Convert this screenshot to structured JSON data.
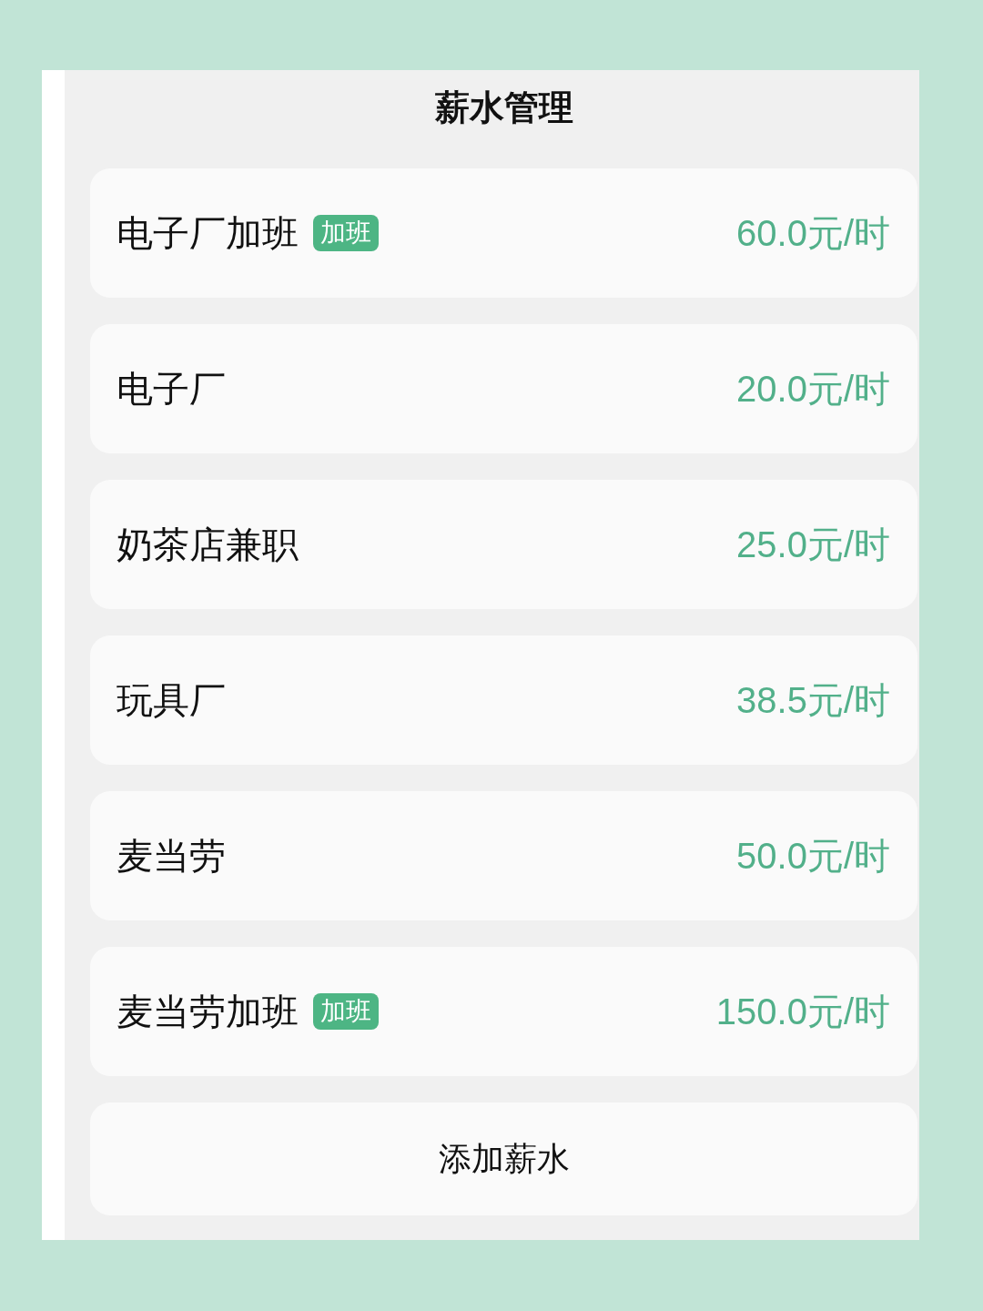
{
  "title": "薪水管理",
  "items": [
    {
      "name": "电子厂加班",
      "tag": "加班",
      "rate": "60.0元/时"
    },
    {
      "name": "电子厂",
      "rate": "20.0元/时"
    },
    {
      "name": "奶茶店兼职",
      "rate": "25.0元/时"
    },
    {
      "name": "玩具厂",
      "rate": "38.5元/时"
    },
    {
      "name": "麦当劳",
      "rate": "50.0元/时"
    },
    {
      "name": "麦当劳加班",
      "tag": "加班",
      "rate": "150.0元/时"
    }
  ],
  "add_button": {
    "label": "添加薪水"
  }
}
